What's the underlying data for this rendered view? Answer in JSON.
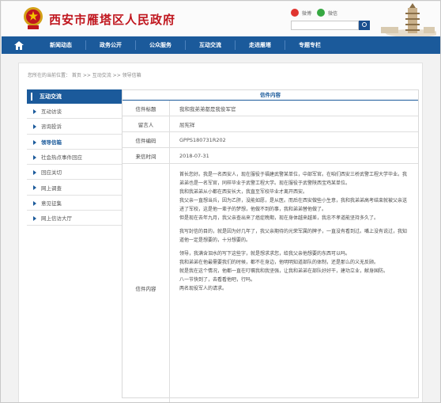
{
  "header": {
    "site_title": "西安市雁塔区人民政府",
    "social": {
      "weibo_label": "微博",
      "wechat_label": "微信"
    },
    "search": {
      "placeholder": ""
    }
  },
  "nav": {
    "items": [
      "新闻动态",
      "政务公开",
      "公众服务",
      "互动交流",
      "走进雁塔",
      "专题专栏"
    ]
  },
  "breadcrumb": "您所在的当前位置： 首页 >> 互动交流 >> 领导信箱",
  "sidebar": {
    "title": "互动交流",
    "items": [
      {
        "label": "互动访谈"
      },
      {
        "label": "咨询投诉"
      },
      {
        "label": "领导信箱"
      },
      {
        "label": "社会热点事件回应"
      },
      {
        "label": "回应关切"
      },
      {
        "label": "网上调查"
      },
      {
        "label": "意见征集"
      },
      {
        "label": "网上信访大厅"
      }
    ]
  },
  "letter": {
    "heading": "信件内容",
    "fields": [
      {
        "key": "信件标题",
        "value": "我和我弟弟都是我俊军官"
      },
      {
        "key": "留言人",
        "value": "屈宪祥"
      },
      {
        "key": "信件编码",
        "value": "GPPS180731R202"
      },
      {
        "key": "来信时间",
        "value": "2018-07-31"
      }
    ],
    "content_key": "信件内容",
    "paragraphs": [
      "首长您好。我是一名西安人，现在服役于福建武警某单位，中部军官。在咱们西安三桥武警工程大学毕业。我弟弟也是一名军官，同样毕业于武警工程大学。现在服役于武警陕西宝鸡某单位。",
      "我和我弟弟从小都在西安长大，我直至军校毕业才离开西安。",
      "我父亲一直想当兵，因为乙肝，没能如愿，是从医。而后在西安做些小生意，我和我弟弟高考结束就被父亲送进了军校，这是他一辈子的梦想，他做不到的事，我和弟弟替他做了。",
      "但是现在去年九月，我父亲查出来了癌症晚期，现在身体越来越差，我忠不孝道能坚持多久了。",
      "",
      "我写封信的目的，就是因为好几年了，我父亲期待的光荣军属的牌子，一直没有看到过。嘴上没有说过，我知道他一定是想要的，十分想要的。",
      "",
      "领导，我满含泪水的写下这些字，就是想求求您，给我父亲他想要的东西可以吗。",
      "我和弟弟在他最需要我们的时候，都不在身边，他明明知道部队的体制，还是那么的义无反顾。",
      "就是我在这个情况，他都一直在叮嘱我和我坚强，让我和弟弟在部队好好干，建功立业，献身国防。",
      "八一节快到了，去看看他吧，行吗。",
      "两名现役军人的请求。"
    ]
  }
}
